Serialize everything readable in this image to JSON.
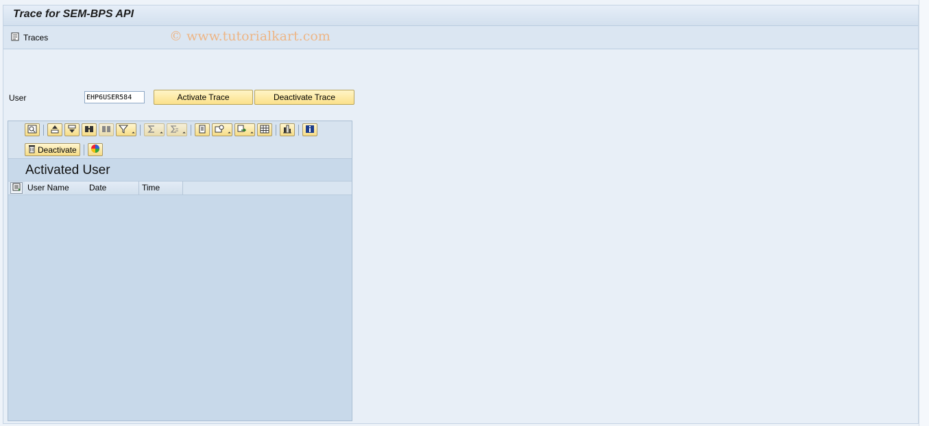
{
  "window": {
    "title": "Trace for SEM-BPS API"
  },
  "app_toolbar": {
    "traces_label": "Traces"
  },
  "watermark": "© www.tutorialkart.com",
  "form": {
    "user_label": "User",
    "user_value": "EHP6USER584",
    "activate_label": "Activate Trace",
    "deactivate_label": "Deactivate Trace"
  },
  "alv": {
    "deactivate_label": "Deactivate",
    "title": "Activated User",
    "columns": [
      "User Name",
      "Date",
      "Time"
    ]
  },
  "colors": {
    "button_yellow": "#fbe18a",
    "panel_bg": "#c8d9ea",
    "title_bar": "#d3e0ee"
  }
}
